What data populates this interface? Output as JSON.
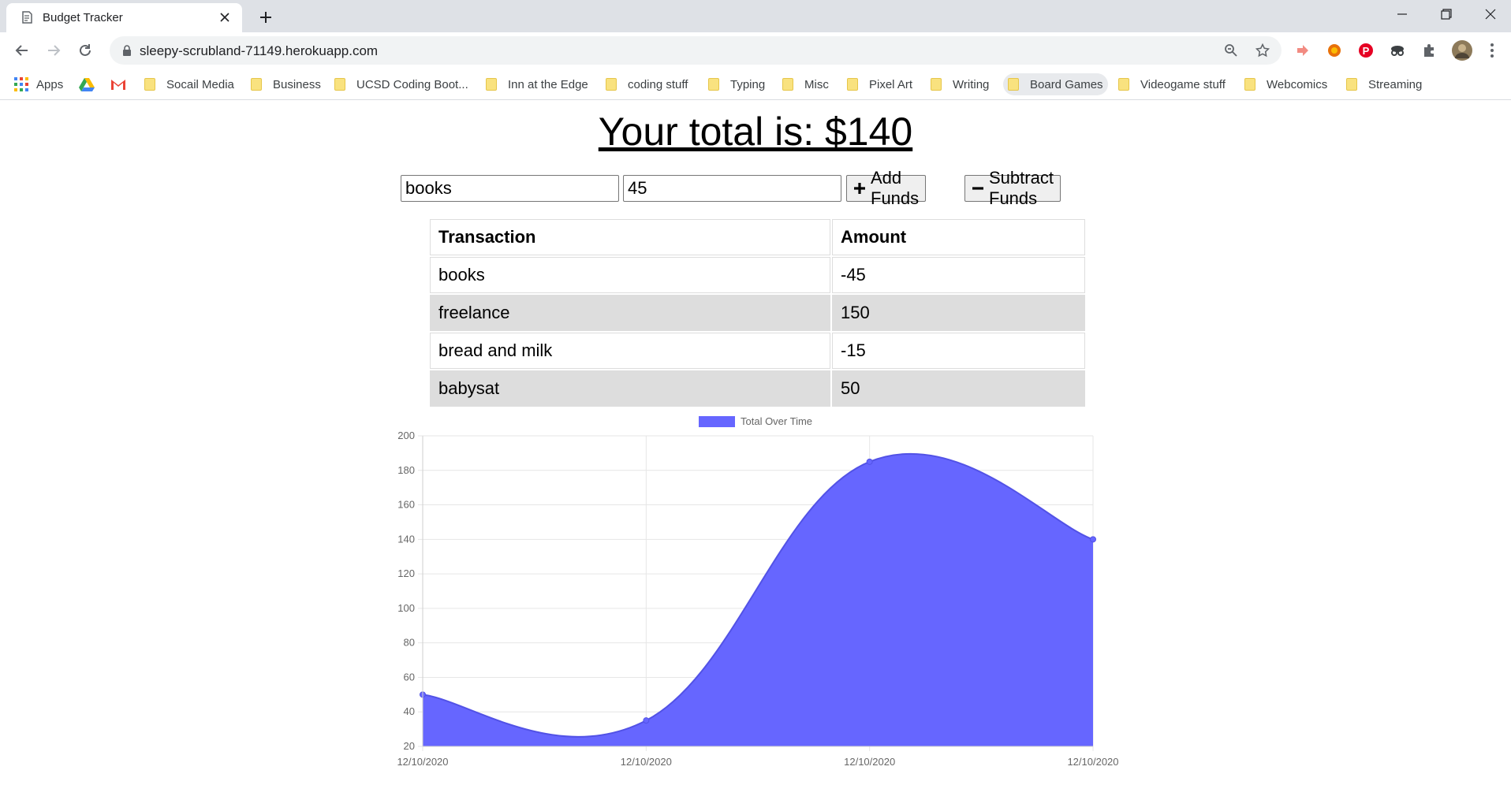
{
  "browser": {
    "tab_title": "Budget Tracker",
    "url": "sleepy-scrubland-71149.herokuapp.com",
    "bookmarks": [
      {
        "label": "Apps",
        "icon": "apps-grid-icon"
      },
      {
        "label": "",
        "icon": "google-drive-icon"
      },
      {
        "label": "",
        "icon": "gmail-icon"
      },
      {
        "label": "Socail Media",
        "icon": "folder-icon"
      },
      {
        "label": "Business",
        "icon": "folder-icon"
      },
      {
        "label": "UCSD Coding Boot...",
        "icon": "folder-icon"
      },
      {
        "label": "Inn at the Edge",
        "icon": "folder-icon"
      },
      {
        "label": "coding stuff",
        "icon": "folder-icon"
      },
      {
        "label": "Typing",
        "icon": "folder-icon"
      },
      {
        "label": "Misc",
        "icon": "folder-icon"
      },
      {
        "label": "Pixel Art",
        "icon": "folder-icon"
      },
      {
        "label": "Writing",
        "icon": "folder-icon"
      },
      {
        "label": "Board Games",
        "icon": "folder-icon"
      },
      {
        "label": "Videogame stuff",
        "icon": "folder-icon"
      },
      {
        "label": "Webcomics",
        "icon": "folder-icon"
      },
      {
        "label": "Streaming",
        "icon": "folder-icon"
      }
    ]
  },
  "app": {
    "total_text": "Your total is: $140",
    "name_input_value": "books",
    "amount_input_value": "45",
    "add_label": "Add Funds",
    "subtract_label": "Subtract Funds",
    "table": {
      "headers": [
        "Transaction",
        "Amount"
      ],
      "rows": [
        [
          "books",
          "-45"
        ],
        [
          "freelance",
          "150"
        ],
        [
          "bread and milk",
          "-15"
        ],
        [
          "babysat",
          "50"
        ]
      ]
    }
  },
  "chart_data": {
    "type": "area",
    "x": [
      "12/10/2020",
      "12/10/2020",
      "12/10/2020",
      "12/10/2020"
    ],
    "series": [
      {
        "name": "Total Over Time",
        "values": [
          50,
          35,
          185,
          140
        ]
      }
    ],
    "ylim": [
      20,
      200
    ],
    "yticks": [
      20,
      40,
      60,
      80,
      100,
      120,
      140,
      160,
      180,
      200
    ],
    "fill_color": "#6666ff",
    "grid": true,
    "legend": "top-center"
  }
}
